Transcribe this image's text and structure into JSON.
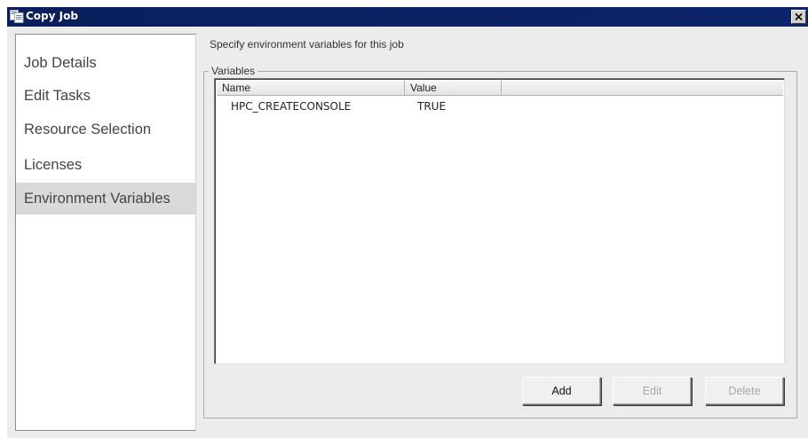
{
  "window": {
    "title": "Copy Job",
    "close_glyph": "✕",
    "icon": "copy-job-icon",
    "title_bar_color": "#0c246b"
  },
  "nav": {
    "items": [
      {
        "label": "Job Details",
        "selected": false
      },
      {
        "label": "Edit Tasks",
        "selected": false
      },
      {
        "label": "Resource Selection",
        "selected": false
      },
      {
        "label": "Licenses",
        "selected": false
      },
      {
        "label": "Environment Variables",
        "selected": true
      }
    ]
  },
  "main": {
    "instruction": "Specify environment variables for this job",
    "group_label": "Variables",
    "table": {
      "columns": [
        "Name",
        "Value"
      ],
      "rows": [
        {
          "name": "HPC_CREATECONSOLE",
          "value": "TRUE"
        }
      ]
    },
    "buttons": {
      "add": "Add",
      "edit": "Edit",
      "delete": "Delete"
    }
  }
}
